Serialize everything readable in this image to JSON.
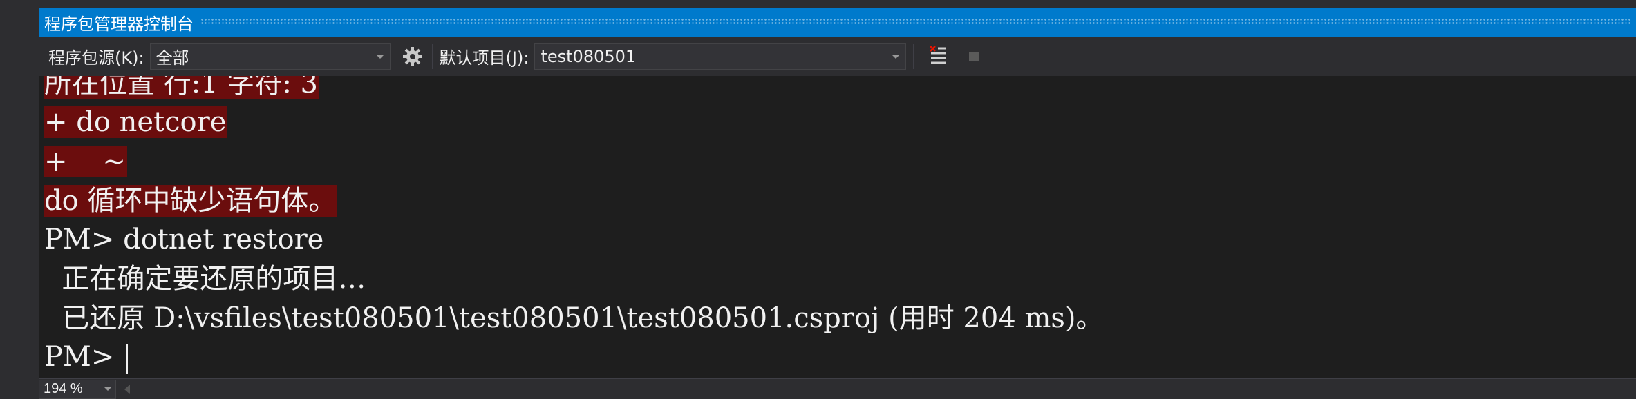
{
  "window": {
    "title": "程序包管理器控制台"
  },
  "toolbar": {
    "source_label": "程序包源(K):",
    "source_value": "全部",
    "project_label": "默认项目(J):",
    "project_value": "test080501"
  },
  "console": {
    "lines": [
      {
        "text": "所在位置 行:1 字符: 3",
        "error": true
      },
      {
        "text": "+ do netcore",
        "error": true
      },
      {
        "text": "+    ~",
        "error": true
      },
      {
        "text": "do 循环中缺少语句体。",
        "error": true
      },
      {
        "text": "PM> dotnet restore",
        "error": false
      },
      {
        "text": "  正在确定要还原的项目…",
        "error": false
      },
      {
        "text": "  已还原 D:\\vsfiles\\test080501\\test080501\\test080501.csproj (用时 204 ms)。",
        "error": false
      }
    ],
    "prompt": "PM> "
  },
  "statusbar": {
    "zoom": "194 %"
  },
  "colors": {
    "accent": "#007acc",
    "error_bg": "#6b0d0d",
    "console_bg": "#1e1e1e"
  }
}
